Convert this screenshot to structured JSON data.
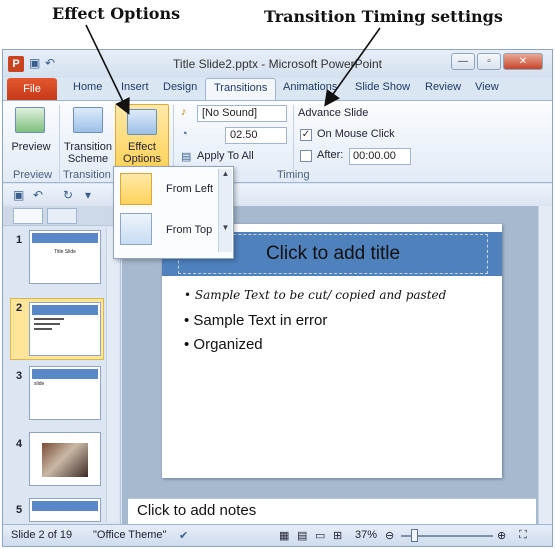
{
  "annotations": {
    "effect_options": "Effect Options",
    "transition_timing": "Transition Timing settings"
  },
  "window": {
    "title": "Title Slide2.pptx - Microsoft PowerPoint",
    "app_letter": "P"
  },
  "tabs": [
    "File",
    "Home",
    "Insert",
    "Design",
    "Transitions",
    "Animations",
    "Slide Show",
    "Review",
    "View"
  ],
  "ribbon": {
    "preview_label": "Preview",
    "transition_scheme_label_1": "Transition",
    "transition_scheme_label_2": "Scheme",
    "effect_options_label_1": "Effect",
    "effect_options_label_2": "Options",
    "sound_value": "[No Sound]",
    "duration_value": "02.50",
    "apply_to_all": "Apply To All",
    "advance_slide_title": "Advance Slide",
    "on_mouse_click": "On Mouse Click",
    "after_label": "After:",
    "after_value": "00:00.00",
    "group_preview": "Preview",
    "group_transition": "Transition t",
    "group_timing": "Timing"
  },
  "effect_menu": {
    "items": [
      {
        "label": "From Left",
        "selected": true
      },
      {
        "label": "From Top",
        "selected": false
      }
    ]
  },
  "slides": [
    {
      "number": "1",
      "title": "Title Slide"
    },
    {
      "number": "2",
      "selected": true
    },
    {
      "number": "3",
      "text": "slide"
    },
    {
      "number": "4"
    },
    {
      "number": "5"
    }
  ],
  "slide": {
    "title": "Click to add title",
    "bullets": [
      "Sample Text to be cut/ copied and pasted",
      "Sample Text in error",
      "Organized"
    ],
    "notes": "Click to add notes"
  },
  "status": {
    "slide_count": "Slide 2 of 19",
    "theme": "\"Office Theme\"",
    "zoom": "37%"
  },
  "colors": {
    "title_bar": "#4f81bd",
    "file_tab": "#c6391a",
    "highlight": "#ffd35c"
  }
}
